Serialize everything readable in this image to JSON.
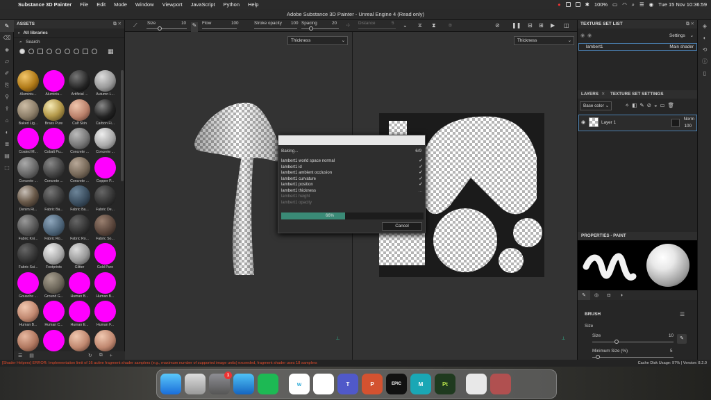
{
  "menubar": {
    "app": "Substance 3D Painter",
    "items": [
      "File",
      "Edit",
      "Mode",
      "Window",
      "Viewport",
      "JavaScript",
      "Python",
      "Help"
    ],
    "battery": "100%",
    "datetime": "Tue 15 Nov  10:36:59"
  },
  "window_title": "Adobe Substance 3D Painter - Unreal Engine 4 (Read only)",
  "assets": {
    "title": "ASSETS",
    "library": "All libraries",
    "search_placeholder": "Search",
    "items": [
      {
        "label": "Aluminiu...",
        "color": "radial-gradient(circle at 35% 30%,#f3c66a,#b07a18 55%,#3e2606)"
      },
      {
        "label": "Aluminiu...",
        "color": "#ff00ff"
      },
      {
        "label": "Artificial ...",
        "color": "radial-gradient(circle at 35% 30%,#777,#222 60%,#050505)"
      },
      {
        "label": "Autumn L...",
        "color": "radial-gradient(circle at 35% 30%,#ddd,#999 55%,#333)"
      },
      {
        "label": "Baked Lig...",
        "color": "radial-gradient(circle at 35% 30%,#cdbda5,#8b7d68 55%,#332d24)"
      },
      {
        "label": "Brass Pure",
        "color": "radial-gradient(circle at 35% 30%,#f6eab5,#b59a4b 50%,#3d3112)"
      },
      {
        "label": "Calf Skin",
        "color": "radial-gradient(circle at 35% 30%,#f0c6ad,#b9806a 55%,#4a2c22)"
      },
      {
        "label": "Carbon Fi...",
        "color": "radial-gradient(circle at 35% 30%,#888,#222 55%,#050505)"
      },
      {
        "label": "Coated M...",
        "color": "#ff00ff"
      },
      {
        "label": "Cobalt Pu...",
        "color": "#ff00ff"
      },
      {
        "label": "Concrete ...",
        "color": "radial-gradient(circle at 35% 30%,#bbb,#777 55%,#2a2a2a)"
      },
      {
        "label": "Concrete ...",
        "color": "radial-gradient(circle at 35% 30%,#eee,#aaa 55%,#444)"
      },
      {
        "label": "Concrete ...",
        "color": "radial-gradient(circle at 35% 30%,#aaa,#666 55%,#222)"
      },
      {
        "label": "Concrete ...",
        "color": "radial-gradient(circle at 35% 30%,#888,#444 55%,#111)"
      },
      {
        "label": "Concrete ...",
        "color": "radial-gradient(circle at 35% 30%,#b8a898,#766858 55%,#2a241e)"
      },
      {
        "label": "Copper P...",
        "color": "#ff00ff"
      },
      {
        "label": "Denim Ri...",
        "color": "radial-gradient(circle at 35% 30%,#c8c0b8,#6a5a4a 50%,#1a1512)"
      },
      {
        "label": "Fabric Ba...",
        "color": "radial-gradient(circle at 35% 30%,#777,#3a3a3a 55%,#111)"
      },
      {
        "label": "Fabric Ba...",
        "color": "radial-gradient(circle at 35% 30%,#6d8599,#3a4d5e 55%,#121a22)"
      },
      {
        "label": "Fabric De...",
        "color": "radial-gradient(circle at 35% 30%,#666,#333 55%,#0d0d0d)"
      },
      {
        "label": "Fabric Kni...",
        "color": "radial-gradient(circle at 35% 30%,#999,#555 55%,#1a1a1a)"
      },
      {
        "label": "Fabric Ro...",
        "color": "radial-gradient(circle at 35% 30%,#8fa7bd,#4d6478 55%,#182430)"
      },
      {
        "label": "Fabric Ro...",
        "color": "radial-gradient(circle at 35% 30%,#666,#333 55%,#0d0d0d)"
      },
      {
        "label": "Fabric So...",
        "color": "radial-gradient(circle at 35% 30%,#9a8070,#5a463c 55%,#1f1713)"
      },
      {
        "label": "Fabric Sui...",
        "color": "radial-gradient(circle at 35% 30%,#666,#333 55%,#0d0d0d)"
      },
      {
        "label": "Footprints",
        "color": "radial-gradient(circle at 35% 30%,#eee,#aaa 55%,#444)"
      },
      {
        "label": "Glitter",
        "color": "radial-gradient(circle at 35% 30%,#ddd,#999 55%,#333)"
      },
      {
        "label": "Gold Pure",
        "color": "#ff00ff"
      },
      {
        "label": "Gouache ...",
        "color": "#ff00ff"
      },
      {
        "label": "Ground G...",
        "color": "radial-gradient(circle at 35% 30%,#a8a090,#6a6458 55%,#22201c)"
      },
      {
        "label": "Human B...",
        "color": "#ff00ff"
      },
      {
        "label": "Human B...",
        "color": "#ff00ff"
      },
      {
        "label": "Human B...",
        "color": "radial-gradient(circle at 35% 30%,#f2c8b0,#c08870 55%,#4a2c22)"
      },
      {
        "label": "Human C...",
        "color": "#ff00ff"
      },
      {
        "label": "Human E...",
        "color": "#ff00ff"
      },
      {
        "label": "Human F...",
        "color": "#ff00ff"
      },
      {
        "label": "",
        "color": "radial-gradient(circle at 35% 30%,#e8b8a0,#b07860 55%,#4a2c22)"
      },
      {
        "label": "",
        "color": "#ff00ff"
      },
      {
        "label": "",
        "color": "radial-gradient(circle at 35% 30%,#f0c8b0,#c08870 55%,#4a2c22)"
      },
      {
        "label": "",
        "color": "radial-gradient(circle at 35% 30%,#f0c8b0,#c08870 55%,#4a2c22)"
      }
    ]
  },
  "toolbar": {
    "size_label": "Size",
    "size_value": "10",
    "flow_label": "Flow",
    "flow_value": "100",
    "stroke_label": "Stroke opacity",
    "stroke_value": "100",
    "spacing_label": "Spacing",
    "spacing_value": "20",
    "distance_label": "Distance",
    "distance_value": "5"
  },
  "viewport": {
    "left_mode": "Thickness",
    "right_mode": "Thickness"
  },
  "bake_dialog": {
    "title": "Baking...",
    "count": "6/9",
    "items": [
      {
        "label": "lambert1 world space normal",
        "done": true
      },
      {
        "label": "lambert1 id",
        "done": true
      },
      {
        "label": "lambert1 ambient occlusion",
        "done": true
      },
      {
        "label": "lambert1 curvature",
        "done": true
      },
      {
        "label": "lambert1 position",
        "done": true
      },
      {
        "label": "lambert1 thickness",
        "done": false,
        "active": true
      },
      {
        "label": "lambert1 height",
        "done": false
      },
      {
        "label": "lambert1 opacity",
        "done": false
      }
    ],
    "progress": 0.66,
    "progress_text": "66%",
    "cancel": "Cancel"
  },
  "texture_set_list": {
    "title": "TEXTURE SET LIST",
    "settings": "Settings",
    "set_name": "lambert1",
    "shader": "Main shader"
  },
  "layers": {
    "tab_layers": "LAYERS",
    "tab_tss": "TEXTURE SET SETTINGS",
    "channel": "Base color",
    "layer_name": "Layer 1",
    "blend": "Norm",
    "opacity": "100"
  },
  "properties": {
    "title": "PROPERTIES - PAINT",
    "brush": "BRUSH",
    "size_group": "Size",
    "size_label": "Size",
    "size_value": "10",
    "minsize_label": "Minimum Size (%)",
    "minsize_value": "5"
  },
  "statusbar": {
    "error": "[Shader Helpers] ERROR: Implementation limit of 16 active fragment shader samplers (e.g., maximum number of supported image units) exceeded, fragment shader uses 18 samplers",
    "right": "Cache Disk Usage:    97% | Version: 8.2.0"
  },
  "dock": [
    {
      "name": "finder",
      "label": "",
      "bg": "linear-gradient(180deg,#5ac8fa,#1a6dd9)"
    },
    {
      "name": "launchpad",
      "label": "",
      "bg": "linear-gradient(180deg,#ddd,#999)"
    },
    {
      "name": "system-preferences",
      "label": "",
      "bg": "linear-gradient(180deg,#8e8e93,#555)",
      "badge": "1"
    },
    {
      "name": "safari",
      "label": "",
      "bg": "linear-gradient(180deg,#4fc3f7,#1565c0)"
    },
    {
      "name": "spotify",
      "label": "",
      "bg": "#1db954"
    },
    {
      "name": "wunderbucket",
      "label": "w",
      "bg": "#ffffff",
      "fg": "#2aa9d8"
    },
    {
      "name": "acrobat",
      "label": "",
      "bg": "#ffffff",
      "fg": "#d32f2f"
    },
    {
      "name": "teams",
      "label": "T",
      "bg": "#5059c9"
    },
    {
      "name": "powerpoint",
      "label": "P",
      "bg": "#d35230"
    },
    {
      "name": "epic-games",
      "label": "EPIC",
      "bg": "#111111"
    },
    {
      "name": "maya",
      "label": "M",
      "bg": "#1aa7b5"
    },
    {
      "name": "painter",
      "label": "Pt",
      "bg": "#1f3a1f",
      "fg": "#b6e24a"
    },
    {
      "name": "stack",
      "label": "",
      "bg": "#e8e8e8"
    },
    {
      "name": "stack2",
      "label": "",
      "bg": "#b05050"
    },
    {
      "name": "trash",
      "label": "",
      "bg": "transparent"
    }
  ]
}
